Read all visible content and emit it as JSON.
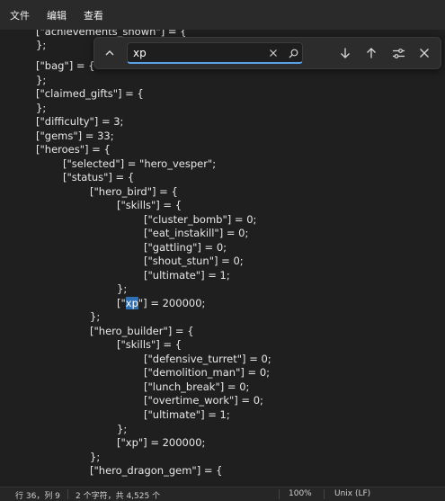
{
  "menu": {
    "file": "文件",
    "edit": "编辑",
    "view": "查看"
  },
  "find": {
    "query": "xp",
    "icons": [
      "chevron-up-icon",
      "clear-icon",
      "search-icon",
      "arrow-down-icon",
      "arrow-up-icon",
      "options-icon",
      "close-icon"
    ]
  },
  "code_lines": [
    "[\"achievements_shown\"] = {",
    "};",
    "[\"bag\"] = {",
    "};",
    "[\"claimed_gifts\"] = {",
    "};",
    "[\"difficulty\"] = 3;",
    "[\"gems\"] = 33;",
    "[\"heroes\"] = {",
    "[\"selected\"] = \"hero_vesper\";",
    "[\"status\"] = {",
    "[\"hero_bird\"] = {",
    "[\"skills\"] = {",
    "[\"cluster_bomb\"] = 0;",
    "[\"eat_instakill\"] = 0;",
    "[\"gattling\"] = 0;",
    "[\"shout_stun\"] = 0;",
    "[\"ultimate\"] = 1;",
    "};",
    "[\"",
    "xp",
    "\"] = 200000;",
    "};",
    "[\"hero_builder\"] = {",
    "[\"skills\"] = {",
    "[\"defensive_turret\"] = 0;",
    "[\"demolition_man\"] = 0;",
    "[\"lunch_break\"] = 0;",
    "[\"overtime_work\"] = 0;",
    "[\"ultimate\"] = 1;",
    "};",
    "[\"xp\"] = 200000;",
    "};",
    "[\"hero_dragon_gem\"] = {"
  ],
  "status": {
    "position": "行 36，列 9",
    "selection": "2 个字符，共 4,525 个",
    "zoom": "100%",
    "line_ending": "Unix (LF)"
  }
}
